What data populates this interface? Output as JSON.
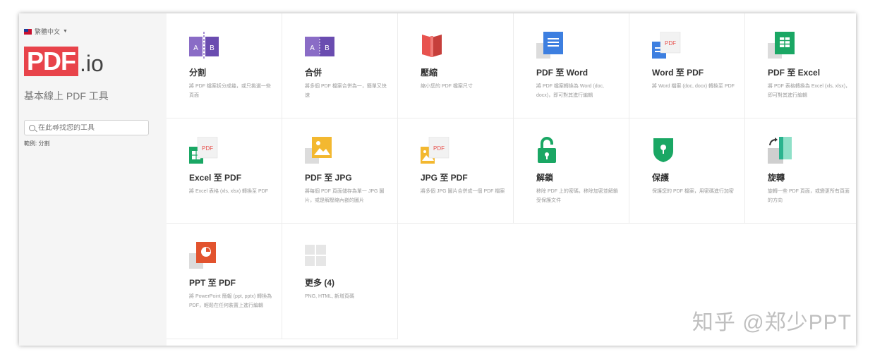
{
  "sidebar": {
    "language": "繁體中文",
    "logo_main": "PDF",
    "logo_suffix": ".io",
    "tagline": "基本線上 PDF 工具",
    "search_placeholder": "在此尋找您的工具",
    "example": "範例: 分割"
  },
  "tools": [
    {
      "title": "分割",
      "desc": "將 PDF 檔案拆分成幾，或只挑選一些頁面",
      "icon": "split-icon"
    },
    {
      "title": "合併",
      "desc": "將多個 PDF 檔案合併為一，簡單又快速",
      "icon": "merge-icon"
    },
    {
      "title": "壓縮",
      "desc": "縮小您的 PDF 檔案尺寸",
      "icon": "compress-icon"
    },
    {
      "title": "PDF 至 Word",
      "desc": "將 PDF 檔案轉換為 Word (doc, docx)，即可對其進行編輯",
      "icon": "pdf-to-word-icon"
    },
    {
      "title": "Word 至 PDF",
      "desc": "將 Word 檔案 (doc, docx) 轉換至 PDF",
      "icon": "word-to-pdf-icon"
    },
    {
      "title": "PDF 至 Excel",
      "desc": "將 PDF 表格轉換為 Excel (xls, xlsx)，即可對其進行編輯",
      "icon": "pdf-to-excel-icon"
    },
    {
      "title": "Excel 至 PDF",
      "desc": "將 Excel 表格 (xls, xlsx) 轉換至 PDF",
      "icon": "excel-to-pdf-icon"
    },
    {
      "title": "PDF 至 JPG",
      "desc": "將每個 PDF 頁面儲存為單一 JPG 圖片，或是解壓縮內嵌的圖片",
      "icon": "pdf-to-jpg-icon"
    },
    {
      "title": "JPG 至 PDF",
      "desc": "將多個 JPG 圖片合併成一個 PDF 檔案",
      "icon": "jpg-to-pdf-icon"
    },
    {
      "title": "解鎖",
      "desc": "移除 PDF 上的密碼，移除加密並解鎖受保護文件",
      "icon": "unlock-icon"
    },
    {
      "title": "保護",
      "desc": "保護您的 PDF 檔案，用密碼進行加密",
      "icon": "protect-icon"
    },
    {
      "title": "旋轉",
      "desc": "旋轉一些 PDF 頁面，或變更所有頁面的方向",
      "icon": "rotate-icon"
    },
    {
      "title": "PPT 至 PDF",
      "desc": "將 PowerPoint 簡報 (ppt, pptx) 轉換為 PDF，輕鬆在任何裝置上進行編輯",
      "icon": "ppt-to-pdf-icon"
    },
    {
      "title": "更多 (4)",
      "desc": "PNG, HTML, 新增頁碼",
      "icon": "more-icon"
    }
  ],
  "watermark": "知乎 @郑少PPT",
  "colors": {
    "logo": "#e8434a",
    "purple": "#8a6cc6",
    "red": "#e8534f",
    "blue": "#3d7fe0",
    "green": "#1aa764",
    "yellow": "#f3b830",
    "teal": "#2ab38e",
    "orange": "#e2532e"
  }
}
